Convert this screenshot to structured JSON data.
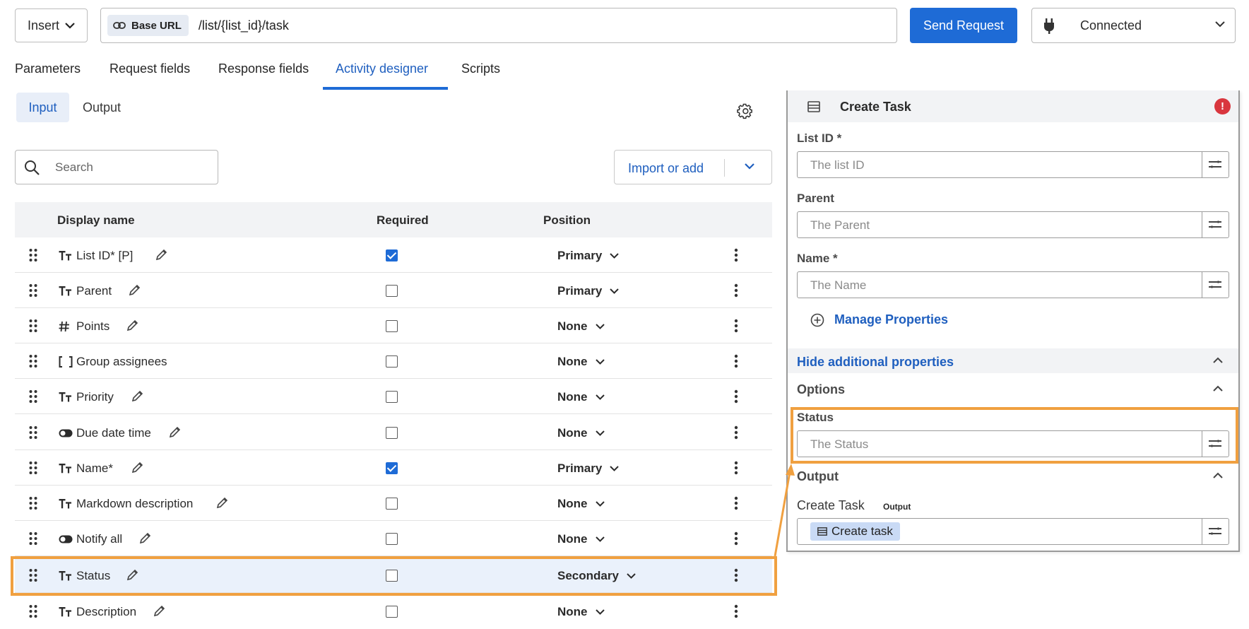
{
  "toolbar": {
    "insert_label": "Insert",
    "base_url_label": "Base URL",
    "url_path": "/list/{list_id}/task",
    "send_label": "Send Request",
    "connection_status": "Connected"
  },
  "tabs": [
    {
      "label": "Parameters",
      "active": false
    },
    {
      "label": "Request fields",
      "active": false
    },
    {
      "label": "Response fields",
      "active": false
    },
    {
      "label": "Activity designer",
      "active": true
    },
    {
      "label": "Scripts",
      "active": false
    }
  ],
  "subtabs": {
    "input": "Input",
    "output": "Output"
  },
  "search": {
    "placeholder": "Search"
  },
  "import_label": "Import or add",
  "table": {
    "columns": [
      "Display name",
      "Required",
      "Position"
    ],
    "rows": [
      {
        "type_icon": "text-type-icon",
        "name": "List ID* [P]",
        "required": true,
        "position": "Primary"
      },
      {
        "type_icon": "text-type-icon",
        "name": "Parent",
        "required": false,
        "position": "Primary"
      },
      {
        "type_icon": "number-type-icon",
        "name": "Points",
        "required": false,
        "position": "None"
      },
      {
        "type_icon": "array-type-icon",
        "name": "Group assignees",
        "required": false,
        "position": "None"
      },
      {
        "type_icon": "text-type-icon",
        "name": "Priority",
        "required": false,
        "position": "None"
      },
      {
        "type_icon": "boolean-type-icon",
        "name": "Due date time",
        "required": false,
        "position": "None"
      },
      {
        "type_icon": "text-type-icon",
        "name": "Name*",
        "required": true,
        "position": "Primary"
      },
      {
        "type_icon": "text-type-icon",
        "name": "Markdown description",
        "required": false,
        "position": "None"
      },
      {
        "type_icon": "boolean-type-icon",
        "name": "Notify all",
        "required": false,
        "position": "None"
      },
      {
        "type_icon": "text-type-icon",
        "name": "Status",
        "required": false,
        "position": "Secondary"
      },
      {
        "type_icon": "text-type-icon",
        "name": "Description",
        "required": false,
        "position": "None"
      }
    ]
  },
  "panel": {
    "title": "Create Task",
    "error_badge": "!",
    "fields": [
      {
        "label": "List ID *",
        "placeholder": "The list ID"
      },
      {
        "label": "Parent",
        "placeholder": "The Parent"
      },
      {
        "label": "Name *",
        "placeholder": "The Name"
      }
    ],
    "manage_properties": "Manage Properties",
    "hide_additional": "Hide additional properties",
    "options_label": "Options",
    "status_label": "Status",
    "status_placeholder": "The Status",
    "output_label": "Output",
    "create_task_label": "Create Task",
    "output_tag": "Output",
    "create_task_chip": "Create task"
  },
  "colors": {
    "accent": "#1e6bd6",
    "highlight": "#f0a040",
    "error": "#d9363e"
  }
}
